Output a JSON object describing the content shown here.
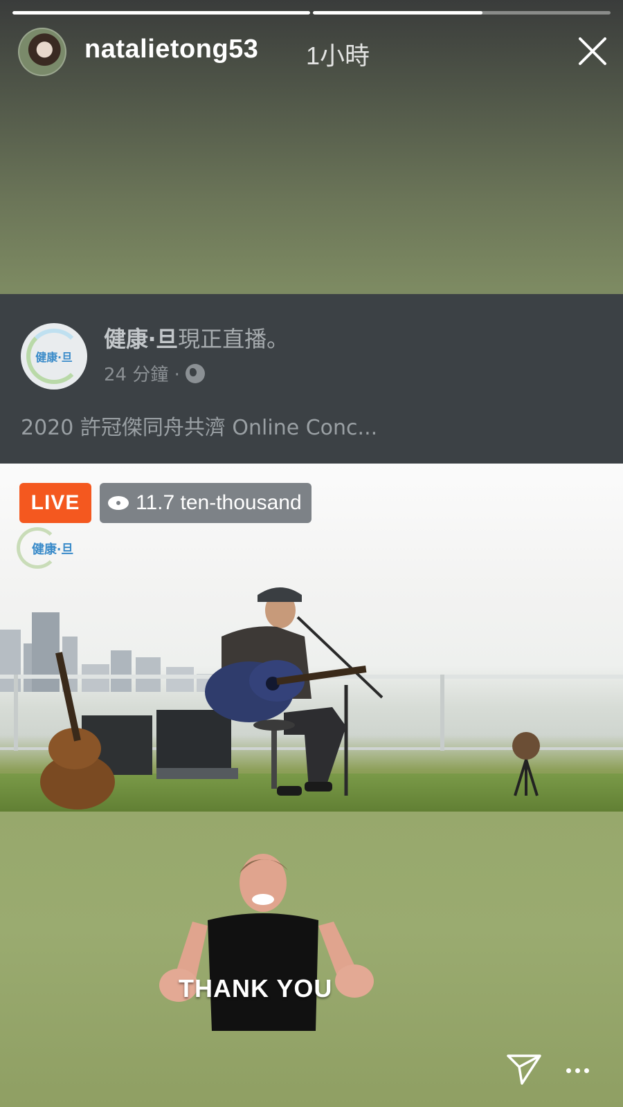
{
  "story": {
    "username": "natalietong53",
    "timestamp": "1小時",
    "progress": [
      1.0,
      0.57
    ]
  },
  "post": {
    "page_name": "健康‧旦",
    "status": "現正直播。",
    "time": "24 分鐘 ·",
    "caption": "2020 許冠傑同舟共濟 Online Conc...",
    "logo_text": "健康‧旦"
  },
  "live": {
    "badge": "LIVE",
    "viewers": "11.7 ten-thousand",
    "logo_text": "健康‧旦"
  },
  "gif": {
    "text": "THANK YOU"
  },
  "icons": {
    "close": "close-icon",
    "send": "send-icon",
    "more": "more-icon",
    "eye": "eye-icon",
    "globe": "globe-icon"
  },
  "colors": {
    "live_badge": "#f4581f",
    "viewer_pill": "#7d8287",
    "post_bg": "#3c4145",
    "story_bg": "#7d8a62"
  }
}
